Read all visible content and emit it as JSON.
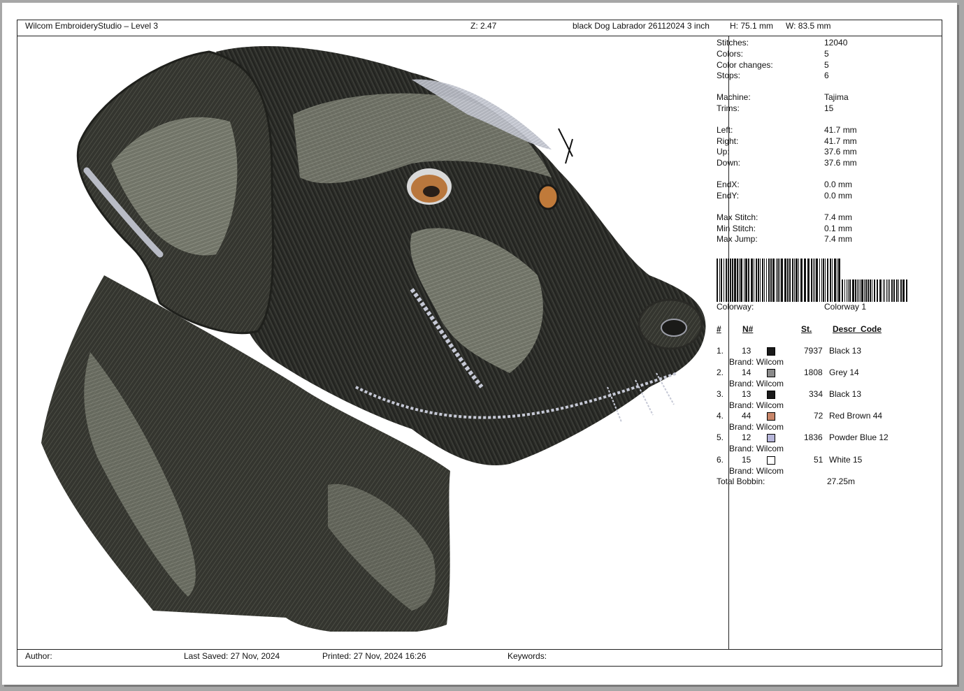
{
  "header": {
    "app_title": "Wilcom EmbroideryStudio – Level 3",
    "zoom": "Z: 2.47",
    "design_name": "black Dog Labrador 26112024 3 inch",
    "height": "H: 75.1 mm",
    "width": "W: 83.5 mm"
  },
  "stats": {
    "stitches": {
      "label": "Stitches:",
      "value": "12040"
    },
    "colors": {
      "label": "Colors:",
      "value": "5"
    },
    "color_changes": {
      "label": "Color changes:",
      "value": "5"
    },
    "stops": {
      "label": "Stops:",
      "value": "6"
    },
    "machine": {
      "label": "Machine:",
      "value": "Tajima"
    },
    "trims": {
      "label": "Trims:",
      "value": "15"
    },
    "left": {
      "label": "Left:",
      "value": "41.7 mm"
    },
    "right": {
      "label": "Right:",
      "value": "41.7 mm"
    },
    "up": {
      "label": "Up:",
      "value": "37.6 mm"
    },
    "down": {
      "label": "Down:",
      "value": "37.6 mm"
    },
    "endx": {
      "label": "EndX:",
      "value": "0.0 mm"
    },
    "endy": {
      "label": "EndY:",
      "value": "0.0 mm"
    },
    "max_stitch": {
      "label": "Max Stitch:",
      "value": "7.4 mm"
    },
    "min_stitch": {
      "label": "Min Stitch:",
      "value": "0.1 mm"
    },
    "max_jump": {
      "label": "Max Jump:",
      "value": "7.4 mm"
    },
    "colorway": {
      "label": "Colorway:",
      "value": "Colorway 1"
    }
  },
  "color_table": {
    "headers": {
      "num": "#",
      "n": "N#",
      "st": "St.",
      "descr": "Descr_Code"
    },
    "rows": [
      {
        "idx": "1.",
        "n": "13",
        "swatch": "#1a1a1a",
        "st": "7937",
        "descr": "Black 13",
        "brand": "Brand: Wilcom"
      },
      {
        "idx": "2.",
        "n": "14",
        "swatch": "#8a8a8a",
        "st": "1808",
        "descr": "Grey 14",
        "brand": "Brand: Wilcom"
      },
      {
        "idx": "3.",
        "n": "13",
        "swatch": "#1a1a1a",
        "st": "334",
        "descr": "Black 13",
        "brand": "Brand: Wilcom"
      },
      {
        "idx": "4.",
        "n": "44",
        "swatch": "#c8866a",
        "st": "72",
        "descr": "Red Brown 44",
        "brand": "Brand: Wilcom"
      },
      {
        "idx": "5.",
        "n": "12",
        "swatch": "#b7b6d9",
        "st": "1836",
        "descr": "Powder Blue 12",
        "brand": "Brand: Wilcom"
      },
      {
        "idx": "6.",
        "n": "15",
        "swatch": "#ffffff",
        "st": "51",
        "descr": "White 15",
        "brand": "Brand: Wilcom"
      }
    ],
    "total_bobbin": {
      "label": "Total Bobbin:",
      "value": "27.25m"
    }
  },
  "footer": {
    "author": "Author:",
    "last_saved": "Last Saved: 27 Nov, 2024",
    "printed": "Printed: 27 Nov, 2024 16:26",
    "keywords": "Keywords:"
  }
}
